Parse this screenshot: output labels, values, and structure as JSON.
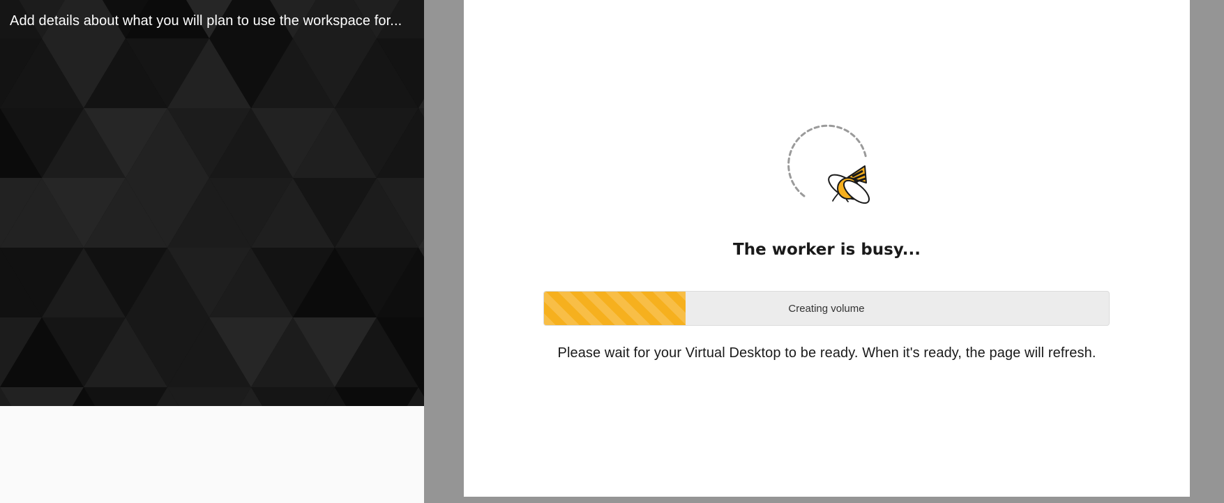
{
  "sidebar": {
    "description": "Add details about what you will plan to use the workspace for..."
  },
  "modal": {
    "title": "The worker is busy...",
    "progress": {
      "label": "Creating volume",
      "fraction": 0.25,
      "color": "#f6b01e"
    },
    "message": "Please wait for your Virtual Desktop to be ready. When it's ready, the page will refresh."
  },
  "icons": {
    "loader": "bee-icon"
  },
  "colors": {
    "overlay": "#959595",
    "accent": "#f6b01e",
    "panel": "#0a0a0a"
  }
}
